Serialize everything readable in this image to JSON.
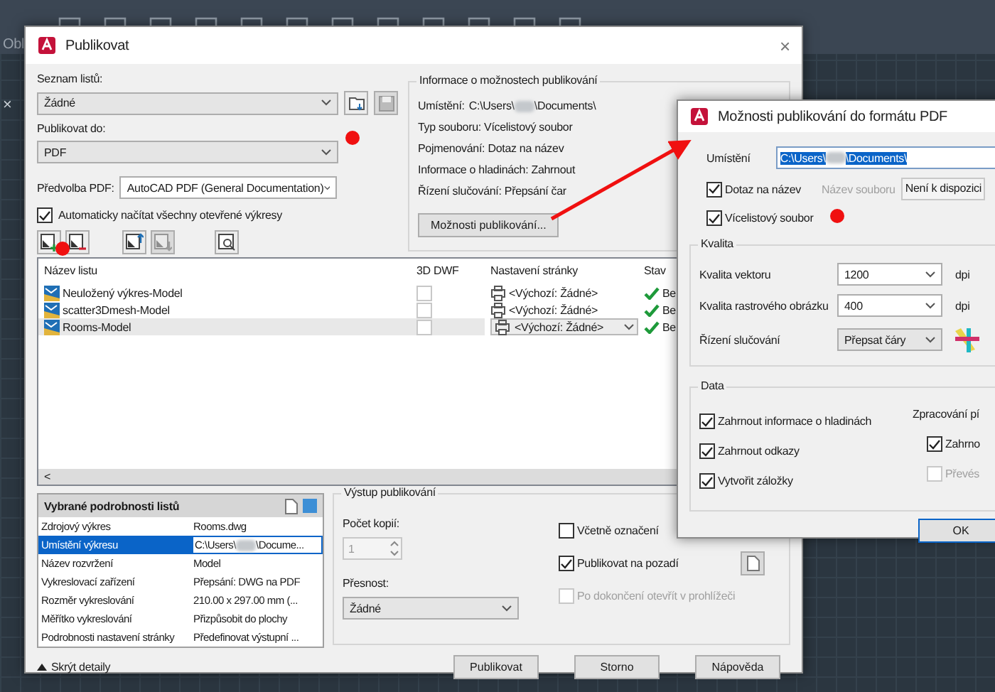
{
  "background": {
    "toolbar_label": "Obl",
    "tab_close": "×"
  },
  "publish_dialog": {
    "title": "Publikovat",
    "close": "×",
    "sheet_list": {
      "label": "Seznam listů:",
      "value": "Žádné"
    },
    "publish_to": {
      "label": "Publikovat do:",
      "value": "PDF"
    },
    "pdf_preset": {
      "label": "Předvolba PDF:",
      "value": "AutoCAD PDF (General Documentation)"
    },
    "auto_load": {
      "label": "Automaticky načítat všechny otevřené výkresy",
      "checked": true
    },
    "sheet_tools": [
      {
        "kind": "add",
        "disabled": false
      },
      {
        "kind": "remove",
        "disabled": false
      },
      {
        "kind": "up",
        "disabled": false
      },
      {
        "kind": "down",
        "disabled": true
      },
      {
        "kind": "preview",
        "disabled": false
      }
    ],
    "info": {
      "title": "Informace o možnostech publikování",
      "location_label": "Umístění:",
      "location_start": "C:\\Users\\",
      "location_end": "\\Documents\\",
      "lines": [
        "Typ souboru: Vícelistový soubor",
        "Pojmenování: Dotaz na název",
        "Informace o hladinách: Zahrnout",
        "Řízení slučování: Přepsání čar"
      ],
      "button": "Možnosti publikování..."
    },
    "sheets": {
      "columns": [
        "Název listu",
        "3D DWF",
        "Nastavení stránky",
        "Stav"
      ],
      "scroll_left": "<",
      "rows": [
        {
          "name": "Neuložený výkres-Model",
          "dwf": false,
          "page_setup": "<Výchozí: Žádné>",
          "status": "Be",
          "selected": false
        },
        {
          "name": "scatter3Dmesh-Model",
          "dwf": false,
          "page_setup": "<Výchozí: Žádné>",
          "status": "Be",
          "selected": false
        },
        {
          "name": "Rooms-Model",
          "dwf": false,
          "page_setup": "<Výchozí: Žádné>",
          "status": "Be",
          "selected": true
        }
      ]
    },
    "details": {
      "title": "Vybrané podrobnosti listů",
      "rows": [
        {
          "label": "Zdrojový výkres",
          "value": "Rooms.dwg",
          "selected": false
        },
        {
          "label": "Umístění výkresu",
          "value": "C:\\Users\\",
          "value_end": "\\Docume...",
          "selected": true
        },
        {
          "label": "Název rozvržení",
          "value": "Model",
          "selected": false
        },
        {
          "label": "Vykreslovací zařízení",
          "value": "Přepsání: DWG na PDF",
          "selected": false
        },
        {
          "label": "Rozměr vykreslování",
          "value": "210.00 x 297.00 mm (...",
          "selected": false
        },
        {
          "label": "Měřítko vykreslování",
          "value": "Přizpůsobit do plochy",
          "selected": false
        },
        {
          "label": "Podrobnosti nastavení stránky",
          "value": "Předefinovat výstupní ...",
          "selected": false
        }
      ]
    },
    "hide_details": "Skrýt detaily",
    "output": {
      "title": "Výstup publikování",
      "copies_label": "Počet kopií:",
      "copies": "1",
      "precision_label": "Přesnost:",
      "precision": "Žádné",
      "options": [
        {
          "label": "Včetně označení",
          "checked": false,
          "disabled": false
        },
        {
          "label": "Publikovat na pozadí",
          "checked": true,
          "disabled": false
        },
        {
          "label": "Po dokončení otevřít v prohlížeči",
          "checked": false,
          "disabled": true
        }
      ]
    },
    "buttons": [
      "Publikovat",
      "Storno",
      "Nápověda"
    ]
  },
  "pdf_options_dialog": {
    "title": "Možnosti publikování do formátu PDF",
    "location_label": "Umístění",
    "location_start": "C:\\Users\\",
    "location_end": "\\Documents\\",
    "ask_name": {
      "label": "Dotaz na název",
      "checked": true
    },
    "file_name_label": "Název souboru",
    "file_name": "Není k dispozici",
    "multi_sheet": {
      "label": "Vícelistový soubor",
      "checked": true
    },
    "quality": {
      "title": "Kvalita",
      "rows": [
        {
          "label": "Kvalita vektoru",
          "value": "1200",
          "unit": "dpi"
        },
        {
          "label": "Kvalita rastrového obrázku",
          "value": "400",
          "unit": "dpi"
        },
        {
          "label": "Řízení slučování",
          "value": "Přepsat čáry"
        }
      ]
    },
    "data": {
      "title": "Data",
      "options": [
        {
          "label": "Zahrnout informace o hladinách",
          "checked": true
        },
        {
          "label": "Zahrnout odkazy",
          "checked": true
        },
        {
          "label": "Vytvořit záložky",
          "checked": true
        }
      ],
      "fonts_title": "Zpracování pí",
      "font_options": [
        {
          "label": "Zahrno",
          "checked": true,
          "disabled": false
        },
        {
          "label": "Převés",
          "checked": false,
          "disabled": true
        }
      ]
    },
    "ok": "OK"
  }
}
